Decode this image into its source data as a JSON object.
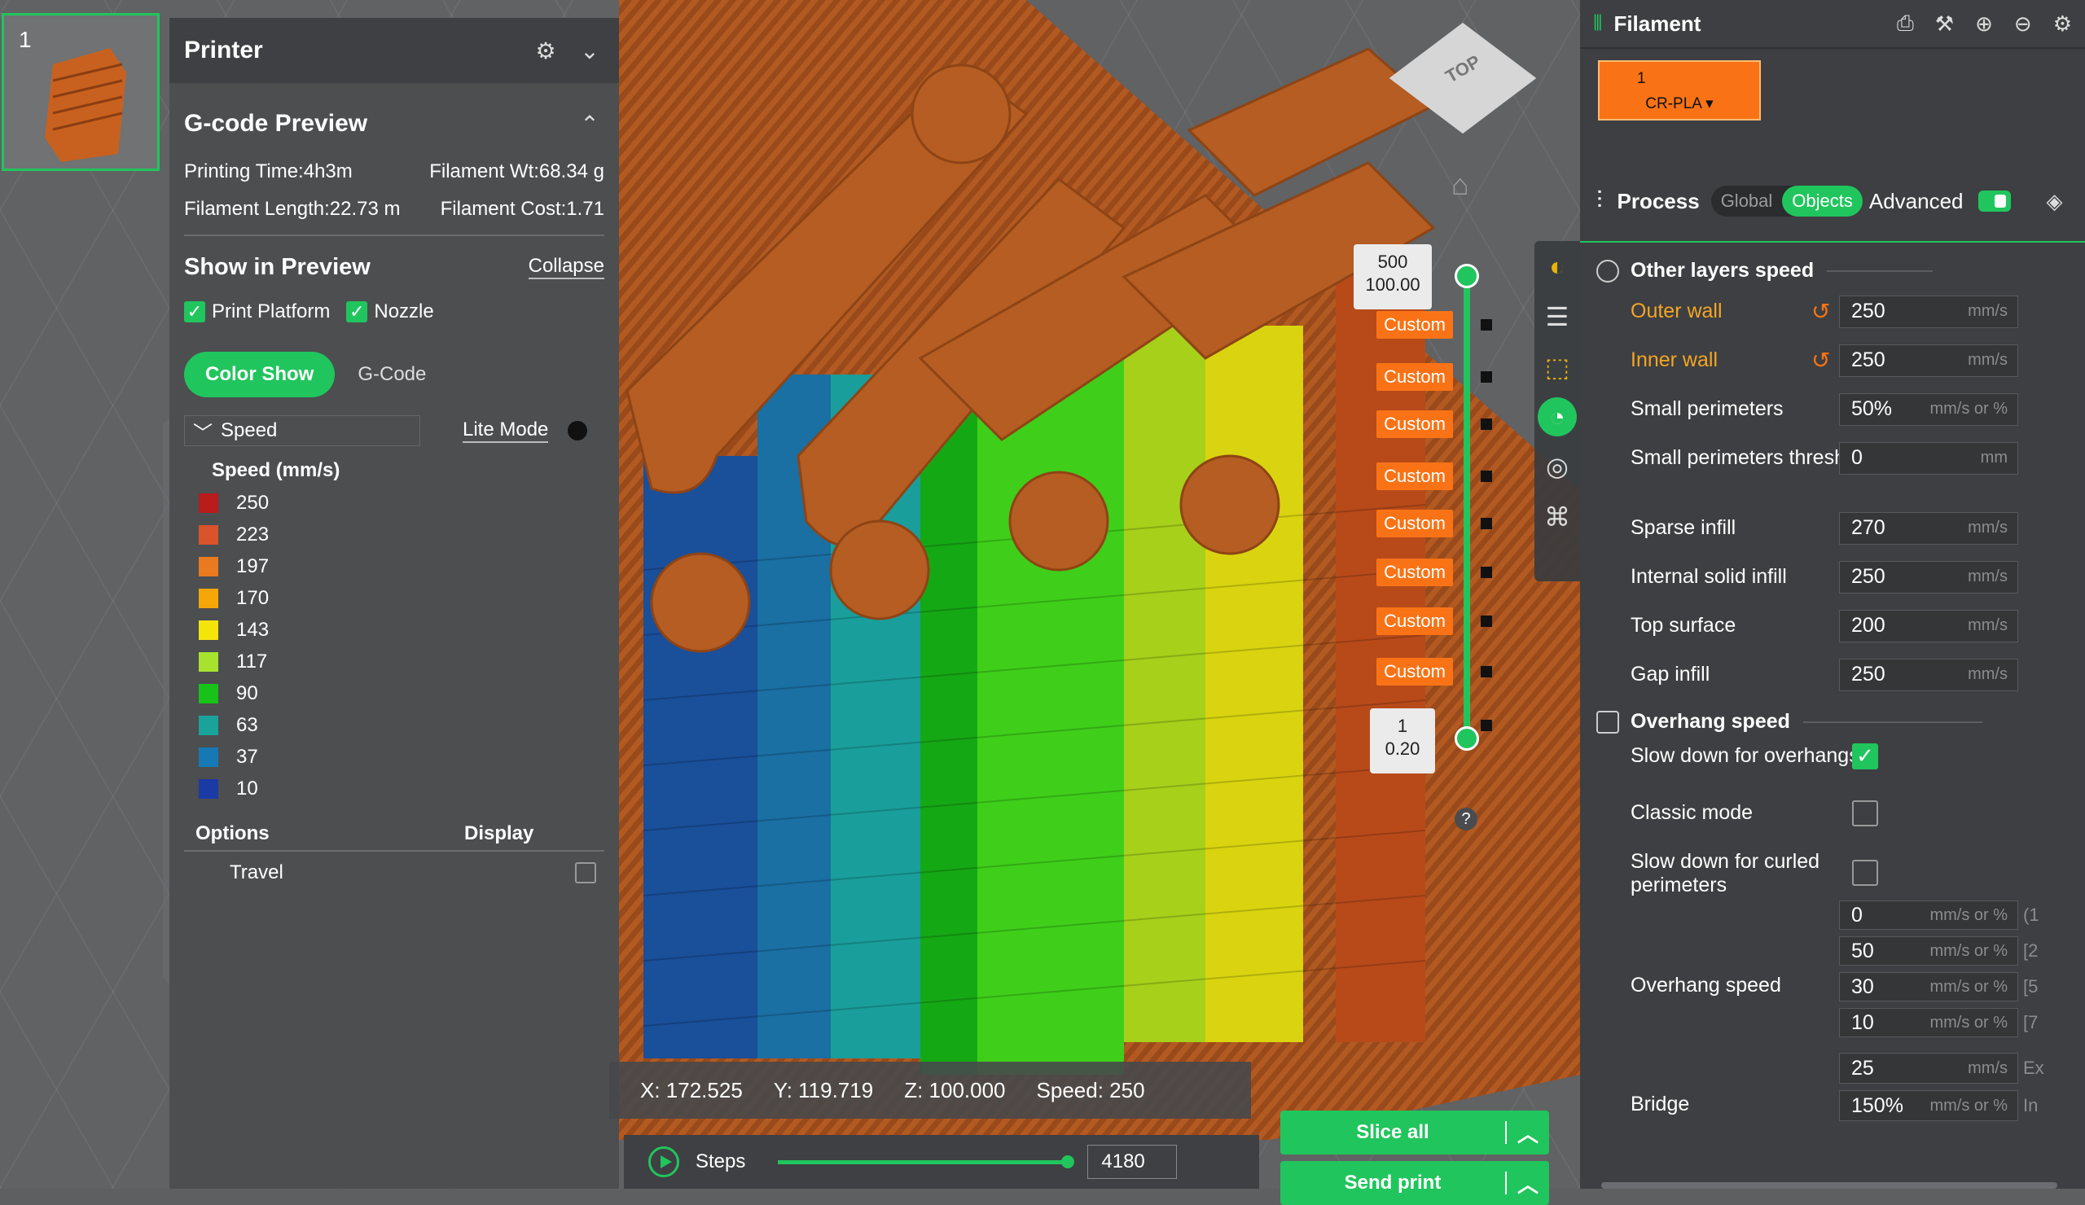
{
  "thumbnail": {
    "plate_number": "1"
  },
  "left_panel": {
    "title": "Printer",
    "gcode_preview": {
      "title": "G-code Preview",
      "printing_time": "Printing Time:4h3m",
      "filament_wt": "Filament Wt:68.34 g",
      "filament_length": "Filament Length:22.73 m",
      "filament_cost": "Filament Cost:1.71"
    },
    "show_in_preview": {
      "title": "Show in Preview",
      "collapse": "Collapse",
      "print_platform": "Print Platform",
      "nozzle": "Nozzle"
    },
    "tabs": {
      "color_show": "Color Show",
      "gcode": "G-Code"
    },
    "view_type": "Speed",
    "lite_mode": "Lite Mode",
    "legend_title": "Speed (mm/s)",
    "legend": [
      {
        "value": "250",
        "color": "#b91c1c"
      },
      {
        "value": "223",
        "color": "#d9542b"
      },
      {
        "value": "197",
        "color": "#ea7a1f"
      },
      {
        "value": "170",
        "color": "#f5a70a"
      },
      {
        "value": "143",
        "color": "#f3e40a"
      },
      {
        "value": "117",
        "color": "#a6e22e"
      },
      {
        "value": "90",
        "color": "#18c218"
      },
      {
        "value": "63",
        "color": "#1aa39a"
      },
      {
        "value": "37",
        "color": "#1679b5"
      },
      {
        "value": "10",
        "color": "#1a3aa6"
      }
    ],
    "options": {
      "options_label": "Options",
      "display_label": "Display",
      "travel": "Travel"
    }
  },
  "layer_slider": {
    "top_layer": "500",
    "top_height": "100.00",
    "bottom_layer": "1",
    "bottom_height": "0.20",
    "custom_tags": [
      "Custom",
      "Custom",
      "Custom",
      "Custom",
      "Custom",
      "Custom",
      "Custom",
      "Custom"
    ],
    "help": "?"
  },
  "navcube": {
    "label": "TOP"
  },
  "coords": {
    "x": "X: 172.525",
    "y": "Y: 119.719",
    "z": "Z: 100.000",
    "speed": "Speed: 250"
  },
  "steps": {
    "label": "Steps",
    "value": "4180"
  },
  "actions": {
    "slice_all": "Slice all",
    "send_print": "Send print"
  },
  "right_panel": {
    "filament_title": "Filament",
    "filament_slot": "1",
    "filament_name": "CR-PLA",
    "process_title": "Process",
    "global": "Global",
    "objects": "Objects",
    "advanced": "Advanced",
    "other_layers_speed": "Other layers speed",
    "fields": [
      {
        "label": "Outer wall",
        "value": "250",
        "unit": "mm/s"
      },
      {
        "label": "Inner wall",
        "value": "250",
        "unit": "mm/s"
      },
      {
        "label": "Small perimeters",
        "value": "50%",
        "unit": "mm/s or %"
      },
      {
        "label": "Small perimeters threshold",
        "value": "0",
        "unit": "mm"
      },
      {
        "label": "Sparse infill",
        "value": "270",
        "unit": "mm/s"
      },
      {
        "label": "Internal solid infill",
        "value": "250",
        "unit": "mm/s"
      },
      {
        "label": "Top surface",
        "value": "200",
        "unit": "mm/s"
      },
      {
        "label": "Gap infill",
        "value": "250",
        "unit": "mm/s"
      }
    ],
    "overhang_speed_title": "Overhang speed",
    "slow_down_overhangs": "Slow down for overhangs",
    "classic_mode": "Classic mode",
    "slow_down_curled": "Slow down for curled perimeters",
    "overhang_speed_label": "Overhang speed",
    "overhang_values": [
      {
        "value": "0",
        "unit": "mm/s or %",
        "side": "(1"
      },
      {
        "value": "50",
        "unit": "mm/s or %",
        "side": "[2"
      },
      {
        "value": "30",
        "unit": "mm/s or %",
        "side": "[5"
      },
      {
        "value": "10",
        "unit": "mm/s or %",
        "side": "[7"
      }
    ],
    "bridge_label": "Bridge",
    "bridge_values": [
      {
        "value": "25",
        "unit": "mm/s",
        "side": "Ex"
      },
      {
        "value": "150%",
        "unit": "mm/s or %",
        "side": "In"
      }
    ]
  }
}
